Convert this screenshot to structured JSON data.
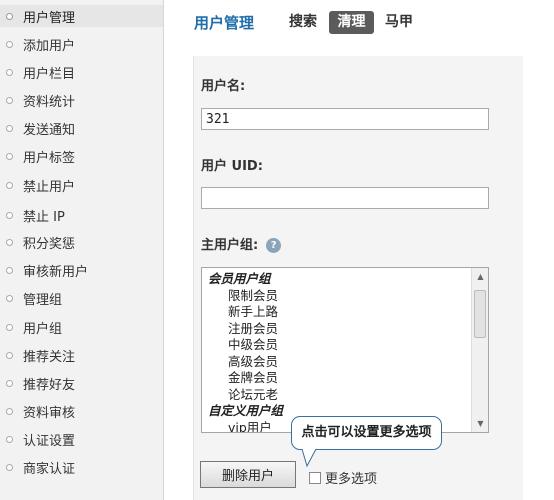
{
  "sidebar": {
    "items": [
      {
        "label": "用户管理",
        "active": true
      },
      {
        "label": "添加用户"
      },
      {
        "label": "用户栏目"
      },
      {
        "label": "资料统计"
      },
      {
        "label": "发送通知"
      },
      {
        "label": "用户标签"
      },
      {
        "label": "禁止用户"
      },
      {
        "label": "禁止 IP"
      },
      {
        "label": "积分奖惩"
      },
      {
        "label": "审核新用户"
      },
      {
        "label": "管理组"
      },
      {
        "label": "用户组"
      },
      {
        "label": "推荐关注"
      },
      {
        "label": "推荐好友"
      },
      {
        "label": "资料审核"
      },
      {
        "label": "认证设置"
      },
      {
        "label": "商家认证"
      }
    ]
  },
  "header": {
    "title": "用户管理",
    "tabs": [
      {
        "label": "搜索"
      },
      {
        "label": "清理",
        "active": true
      },
      {
        "label": "马甲"
      }
    ]
  },
  "form": {
    "username_label": "用户名:",
    "username_value": "321",
    "uid_label": "用户  UID:",
    "uid_value": "",
    "group_label": "主用户组:",
    "help_icon": "?",
    "group_options": [
      {
        "type": "group",
        "label": "会员用户组"
      },
      {
        "type": "option",
        "label": "限制会员"
      },
      {
        "type": "option",
        "label": "新手上路"
      },
      {
        "type": "option",
        "label": "注册会员"
      },
      {
        "type": "option",
        "label": "中级会员"
      },
      {
        "type": "option",
        "label": "高级会员"
      },
      {
        "type": "option",
        "label": "金牌会员"
      },
      {
        "type": "option",
        "label": "论坛元老"
      },
      {
        "type": "group",
        "label": "自定义用户组"
      },
      {
        "type": "option",
        "label": "vip用户"
      }
    ],
    "delete_button": "删除用户",
    "more_options": "更多选项"
  },
  "callout": {
    "text": "点击可以设置更多选项"
  },
  "colors": {
    "title_blue": "#1f6ea9",
    "active_tab_bg": "#5b5b5b",
    "callout_border": "#3a6e9e"
  }
}
